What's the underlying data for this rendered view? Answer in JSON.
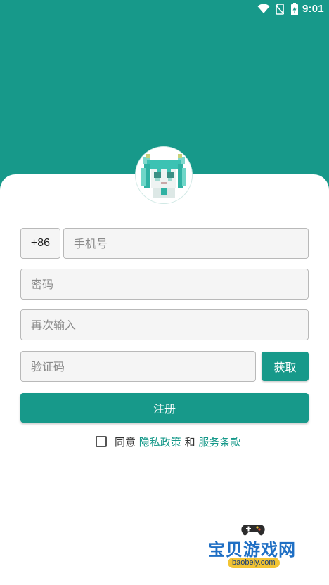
{
  "status_bar": {
    "time": "9:01",
    "icons": [
      "wifi-icon",
      "no-sim-icon",
      "battery-charging-icon"
    ]
  },
  "theme": {
    "primary_color": "#17998a",
    "link_color": "#17998a"
  },
  "form": {
    "country_code": "+86",
    "phone_placeholder": "手机号",
    "password_placeholder": "密码",
    "password_confirm_placeholder": "再次输入",
    "code_placeholder": "验证码",
    "get_code_label": "获取",
    "register_label": "注册"
  },
  "agreement": {
    "checked": false,
    "prefix": "同意 ",
    "privacy_link": "隐私政策",
    "conjunction": " 和 ",
    "terms_link": "服务条款"
  },
  "watermark": {
    "title": "宝贝游戏网",
    "url": "baobeiy.com",
    "icon": "gamepad-icon"
  }
}
